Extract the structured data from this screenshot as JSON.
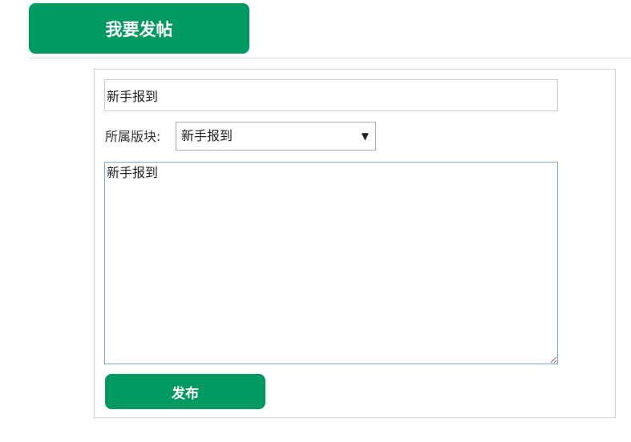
{
  "header": {
    "tab_label": "我要发帖"
  },
  "form": {
    "title_value": "新手报到",
    "board_label": "所属版块:",
    "board_selected": "新手报到",
    "board_arrow": "▼",
    "content_value": "新手报到",
    "submit_label": "发布"
  },
  "colors": {
    "accent": "#009a61",
    "panel_border": "#d4d4d4",
    "textarea_focus_border": "#7aa7de"
  },
  "icons": {
    "select_arrow": "dropdown-arrow-icon"
  }
}
